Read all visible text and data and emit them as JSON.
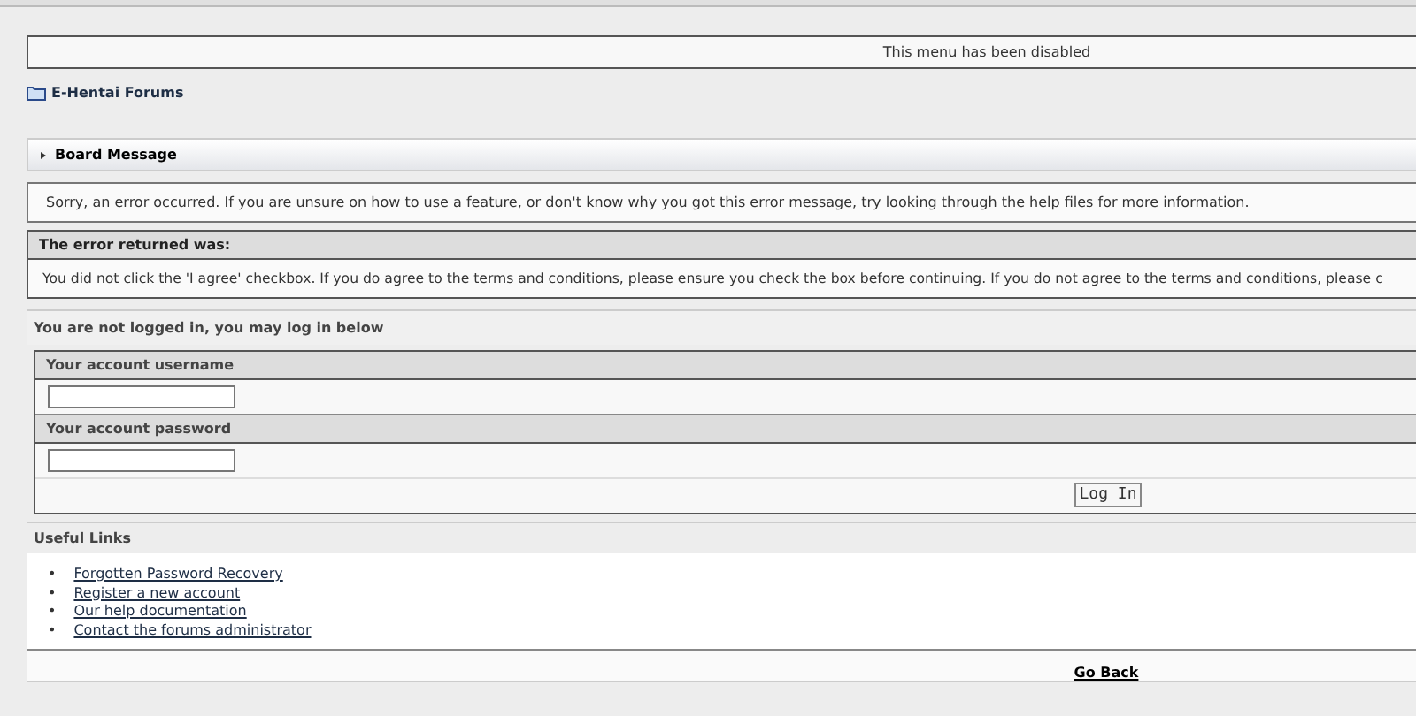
{
  "menu_notice": "This menu has been disabled",
  "breadcrumb": {
    "label": "E-Hentai Forums"
  },
  "board_message": {
    "title": "Board Message",
    "text": "Sorry, an error occurred. If you are unsure on how to use a feature, or don't know why you got this error message, try looking through the help files for more information."
  },
  "error": {
    "title": "The error returned was:",
    "text": "You did not click the 'I agree' checkbox. If you do agree to the terms and conditions, please ensure you check the box before continuing. If you do not agree to the terms and conditions, please c"
  },
  "login": {
    "heading": "You are not logged in, you may log in below",
    "username_label": "Your account username",
    "password_label": "Your account password",
    "button": "Log In"
  },
  "useful_links": {
    "title": "Useful Links",
    "links": [
      {
        "bullet": "•",
        "label": "Forgotten Password Recovery"
      },
      {
        "bullet": "•",
        "label": "Register a new account"
      },
      {
        "bullet": "•",
        "label": "Our help documentation"
      },
      {
        "bullet": "•",
        "label": "Contact the forums administrator"
      }
    ]
  },
  "go_back": "Go Back"
}
